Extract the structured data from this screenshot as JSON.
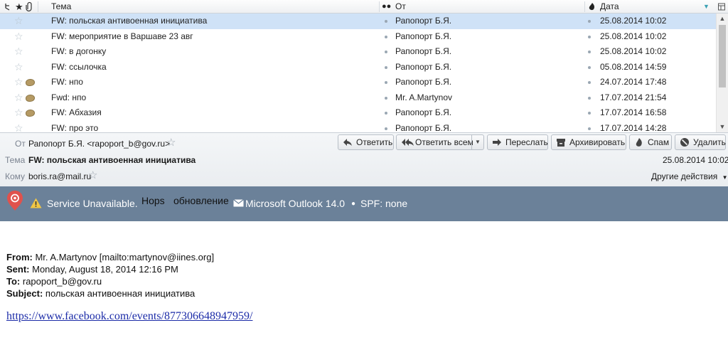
{
  "list": {
    "columns": {
      "subject": "Тема",
      "from": "От",
      "date": "Дата"
    },
    "rows": [
      {
        "subject": "FW: польская антивоенная инициатива",
        "from": "Рапопорт Б.Я.",
        "date": "25.08.2014 10:02",
        "selected": true,
        "tagged": false
      },
      {
        "subject": "FW: мероприятие в Варшаве 23 авг",
        "from": "Рапопорт Б.Я.",
        "date": "25.08.2014 10:02",
        "selected": false,
        "tagged": false
      },
      {
        "subject": "FW: в догонку",
        "from": "Рапопорт Б.Я.",
        "date": "25.08.2014 10:02",
        "selected": false,
        "tagged": false
      },
      {
        "subject": "FW: ссылочка",
        "from": "Рапопорт Б.Я.",
        "date": "05.08.2014 14:59",
        "selected": false,
        "tagged": false
      },
      {
        "subject": "FW: нпо",
        "from": "Рапопорт Б.Я.",
        "date": "24.07.2014 17:48",
        "selected": false,
        "tagged": true
      },
      {
        "subject": "Fwd: нпо",
        "from": "Mr. A.Martynov",
        "date": "17.07.2014 21:54",
        "selected": false,
        "tagged": true
      },
      {
        "subject": "FW: Абхазия",
        "from": "Рапопорт Б.Я.",
        "date": "17.07.2014 16:58",
        "selected": false,
        "tagged": true
      },
      {
        "subject": "FW: про это",
        "from": "Рапопорт Б.Я.",
        "date": "17.07.2014 14:28",
        "selected": false,
        "tagged": false
      }
    ]
  },
  "header": {
    "from_label": "От",
    "from_value": "Рапопорт Б.Я. <rapoport_b@gov.ru>",
    "subject_label": "Тема",
    "subject_value": "FW: польская антивоенная инициатива",
    "date_value": "25.08.2014 10:02",
    "to_label": "Кому",
    "to_value": "boris.ra@mail.ru",
    "other_actions": "Другие действия",
    "buttons": {
      "reply": "Ответить",
      "reply_all": "Ответить всем",
      "forward": "Переслать",
      "archive": "Архивировать",
      "spam": "Спам",
      "delete": "Удалить"
    }
  },
  "banner": {
    "service": "Service Unavailable.",
    "hops": "Hops",
    "update": "обновление",
    "outlook": "Microsoft Outlook 14.0",
    "spf": "SPF: none"
  },
  "body": {
    "from_label": "From:",
    "from_value": "Mr. A.Martynov [mailto:martynov@iines.org]",
    "sent_label": "Sent:",
    "sent_value": "Monday, August 18, 2014 12:16 PM",
    "to_label": "To:",
    "to_value": "rapoport_b@gov.ru",
    "subject_label": "Subject:",
    "subject_value": "польская антивоенная инициатива",
    "link": "https://www.facebook.com/events/877306648947959/"
  },
  "colors": {
    "selected_row": "#cfe2f7",
    "banner": "#6b8199",
    "link": "#1c2ca8",
    "logo": "#e0524d"
  }
}
